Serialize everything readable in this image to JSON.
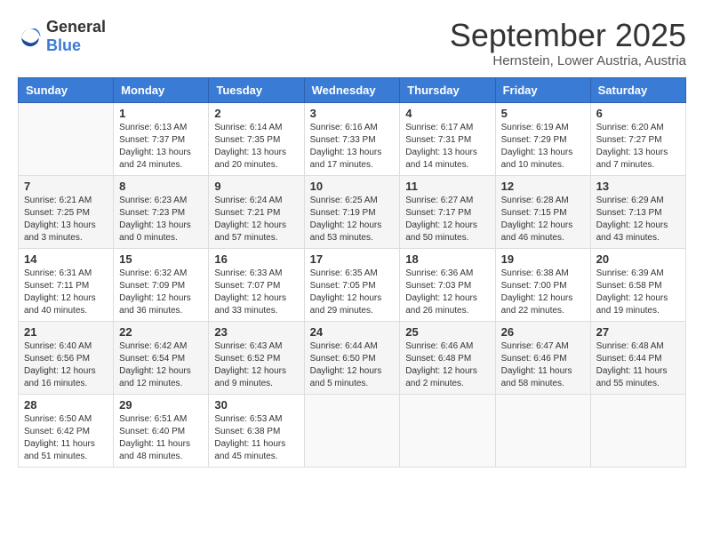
{
  "logo": {
    "general": "General",
    "blue": "Blue"
  },
  "header": {
    "month_year": "September 2025",
    "location": "Hernstein, Lower Austria, Austria"
  },
  "weekdays": [
    "Sunday",
    "Monday",
    "Tuesday",
    "Wednesday",
    "Thursday",
    "Friday",
    "Saturday"
  ],
  "weeks": [
    [
      {
        "day": "",
        "sunrise": "",
        "sunset": "",
        "daylight": ""
      },
      {
        "day": "1",
        "sunrise": "Sunrise: 6:13 AM",
        "sunset": "Sunset: 7:37 PM",
        "daylight": "Daylight: 13 hours and 24 minutes."
      },
      {
        "day": "2",
        "sunrise": "Sunrise: 6:14 AM",
        "sunset": "Sunset: 7:35 PM",
        "daylight": "Daylight: 13 hours and 20 minutes."
      },
      {
        "day": "3",
        "sunrise": "Sunrise: 6:16 AM",
        "sunset": "Sunset: 7:33 PM",
        "daylight": "Daylight: 13 hours and 17 minutes."
      },
      {
        "day": "4",
        "sunrise": "Sunrise: 6:17 AM",
        "sunset": "Sunset: 7:31 PM",
        "daylight": "Daylight: 13 hours and 14 minutes."
      },
      {
        "day": "5",
        "sunrise": "Sunrise: 6:19 AM",
        "sunset": "Sunset: 7:29 PM",
        "daylight": "Daylight: 13 hours and 10 minutes."
      },
      {
        "day": "6",
        "sunrise": "Sunrise: 6:20 AM",
        "sunset": "Sunset: 7:27 PM",
        "daylight": "Daylight: 13 hours and 7 minutes."
      }
    ],
    [
      {
        "day": "7",
        "sunrise": "Sunrise: 6:21 AM",
        "sunset": "Sunset: 7:25 PM",
        "daylight": "Daylight: 13 hours and 3 minutes."
      },
      {
        "day": "8",
        "sunrise": "Sunrise: 6:23 AM",
        "sunset": "Sunset: 7:23 PM",
        "daylight": "Daylight: 13 hours and 0 minutes."
      },
      {
        "day": "9",
        "sunrise": "Sunrise: 6:24 AM",
        "sunset": "Sunset: 7:21 PM",
        "daylight": "Daylight: 12 hours and 57 minutes."
      },
      {
        "day": "10",
        "sunrise": "Sunrise: 6:25 AM",
        "sunset": "Sunset: 7:19 PM",
        "daylight": "Daylight: 12 hours and 53 minutes."
      },
      {
        "day": "11",
        "sunrise": "Sunrise: 6:27 AM",
        "sunset": "Sunset: 7:17 PM",
        "daylight": "Daylight: 12 hours and 50 minutes."
      },
      {
        "day": "12",
        "sunrise": "Sunrise: 6:28 AM",
        "sunset": "Sunset: 7:15 PM",
        "daylight": "Daylight: 12 hours and 46 minutes."
      },
      {
        "day": "13",
        "sunrise": "Sunrise: 6:29 AM",
        "sunset": "Sunset: 7:13 PM",
        "daylight": "Daylight: 12 hours and 43 minutes."
      }
    ],
    [
      {
        "day": "14",
        "sunrise": "Sunrise: 6:31 AM",
        "sunset": "Sunset: 7:11 PM",
        "daylight": "Daylight: 12 hours and 40 minutes."
      },
      {
        "day": "15",
        "sunrise": "Sunrise: 6:32 AM",
        "sunset": "Sunset: 7:09 PM",
        "daylight": "Daylight: 12 hours and 36 minutes."
      },
      {
        "day": "16",
        "sunrise": "Sunrise: 6:33 AM",
        "sunset": "Sunset: 7:07 PM",
        "daylight": "Daylight: 12 hours and 33 minutes."
      },
      {
        "day": "17",
        "sunrise": "Sunrise: 6:35 AM",
        "sunset": "Sunset: 7:05 PM",
        "daylight": "Daylight: 12 hours and 29 minutes."
      },
      {
        "day": "18",
        "sunrise": "Sunrise: 6:36 AM",
        "sunset": "Sunset: 7:03 PM",
        "daylight": "Daylight: 12 hours and 26 minutes."
      },
      {
        "day": "19",
        "sunrise": "Sunrise: 6:38 AM",
        "sunset": "Sunset: 7:00 PM",
        "daylight": "Daylight: 12 hours and 22 minutes."
      },
      {
        "day": "20",
        "sunrise": "Sunrise: 6:39 AM",
        "sunset": "Sunset: 6:58 PM",
        "daylight": "Daylight: 12 hours and 19 minutes."
      }
    ],
    [
      {
        "day": "21",
        "sunrise": "Sunrise: 6:40 AM",
        "sunset": "Sunset: 6:56 PM",
        "daylight": "Daylight: 12 hours and 16 minutes."
      },
      {
        "day": "22",
        "sunrise": "Sunrise: 6:42 AM",
        "sunset": "Sunset: 6:54 PM",
        "daylight": "Daylight: 12 hours and 12 minutes."
      },
      {
        "day": "23",
        "sunrise": "Sunrise: 6:43 AM",
        "sunset": "Sunset: 6:52 PM",
        "daylight": "Daylight: 12 hours and 9 minutes."
      },
      {
        "day": "24",
        "sunrise": "Sunrise: 6:44 AM",
        "sunset": "Sunset: 6:50 PM",
        "daylight": "Daylight: 12 hours and 5 minutes."
      },
      {
        "day": "25",
        "sunrise": "Sunrise: 6:46 AM",
        "sunset": "Sunset: 6:48 PM",
        "daylight": "Daylight: 12 hours and 2 minutes."
      },
      {
        "day": "26",
        "sunrise": "Sunrise: 6:47 AM",
        "sunset": "Sunset: 6:46 PM",
        "daylight": "Daylight: 11 hours and 58 minutes."
      },
      {
        "day": "27",
        "sunrise": "Sunrise: 6:48 AM",
        "sunset": "Sunset: 6:44 PM",
        "daylight": "Daylight: 11 hours and 55 minutes."
      }
    ],
    [
      {
        "day": "28",
        "sunrise": "Sunrise: 6:50 AM",
        "sunset": "Sunset: 6:42 PM",
        "daylight": "Daylight: 11 hours and 51 minutes."
      },
      {
        "day": "29",
        "sunrise": "Sunrise: 6:51 AM",
        "sunset": "Sunset: 6:40 PM",
        "daylight": "Daylight: 11 hours and 48 minutes."
      },
      {
        "day": "30",
        "sunrise": "Sunrise: 6:53 AM",
        "sunset": "Sunset: 6:38 PM",
        "daylight": "Daylight: 11 hours and 45 minutes."
      },
      {
        "day": "",
        "sunrise": "",
        "sunset": "",
        "daylight": ""
      },
      {
        "day": "",
        "sunrise": "",
        "sunset": "",
        "daylight": ""
      },
      {
        "day": "",
        "sunrise": "",
        "sunset": "",
        "daylight": ""
      },
      {
        "day": "",
        "sunrise": "",
        "sunset": "",
        "daylight": ""
      }
    ]
  ]
}
